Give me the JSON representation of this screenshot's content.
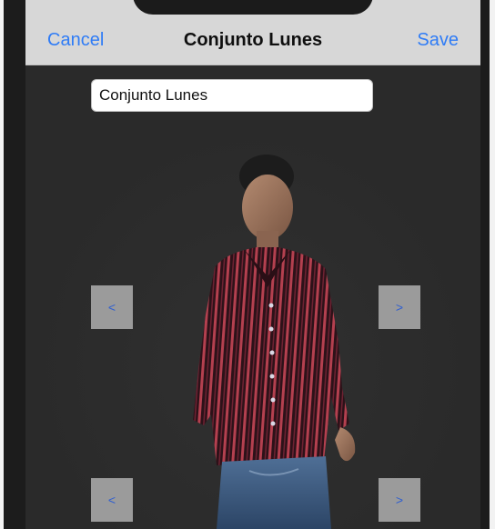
{
  "navigation": {
    "cancel_label": "Cancel",
    "title": "Conjunto Lunes",
    "save_label": "Save"
  },
  "outfit_name": {
    "value": "Conjunto Lunes"
  },
  "selectors": {
    "top_prev": "<",
    "top_next": ">",
    "bottom_prev": "<",
    "bottom_next": ">"
  },
  "colors": {
    "accent": "#2f7cf6",
    "nav_background": "#d7d7d7",
    "stage_background": "#2a2a2a",
    "arrow_button": "#9b9b9b",
    "shirt": "#3a1a22",
    "shirt_stripe": "#b4404f",
    "jeans": "#3f5f86"
  },
  "avatar": {
    "icon": "avatar-3d-model",
    "top": "striped-shirt",
    "bottom": "jeans"
  }
}
